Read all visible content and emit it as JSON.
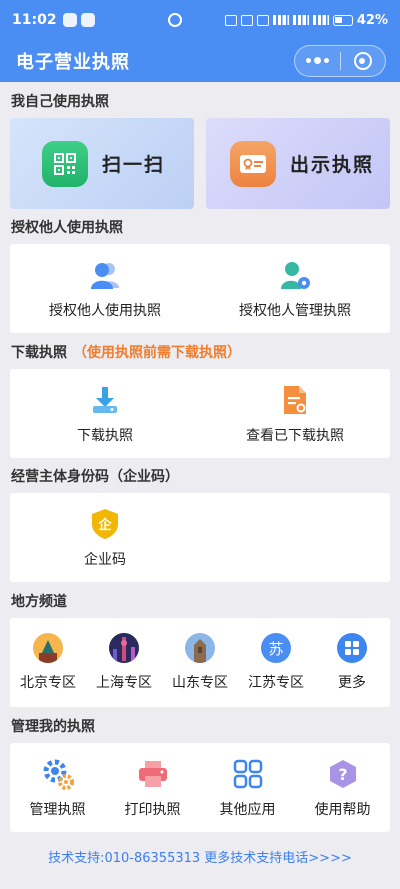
{
  "status_bar": {
    "time": "11:02",
    "battery": "42%"
  },
  "nav": {
    "title": "电子营业执照"
  },
  "sections": {
    "self_use": "我自己使用执照",
    "authorize": "授权他人使用执照",
    "download": "下载执照",
    "download_note": "（使用执照前需下载执照）",
    "entity_code": "经营主体身份码（企业码）",
    "region": "地方频道",
    "manage": "管理我的执照"
  },
  "self_use": {
    "scan": "扫一扫",
    "show": "出示执照"
  },
  "authorize": {
    "use": "授权他人使用执照",
    "manage": "授权他人管理执照"
  },
  "download": {
    "download": "下载执照",
    "view": "查看已下载执照"
  },
  "entity_code": {
    "item": "企业码",
    "badge": "企"
  },
  "region": {
    "items": [
      "北京专区",
      "上海专区",
      "山东专区",
      "江苏专区",
      "更多"
    ],
    "jiangsu_badge": "苏"
  },
  "manage": {
    "items": [
      "管理执照",
      "打印执照",
      "其他应用",
      "使用帮助"
    ]
  },
  "footer": {
    "support": "技术支持:010-86355313  更多技术支持电话>>>>"
  }
}
